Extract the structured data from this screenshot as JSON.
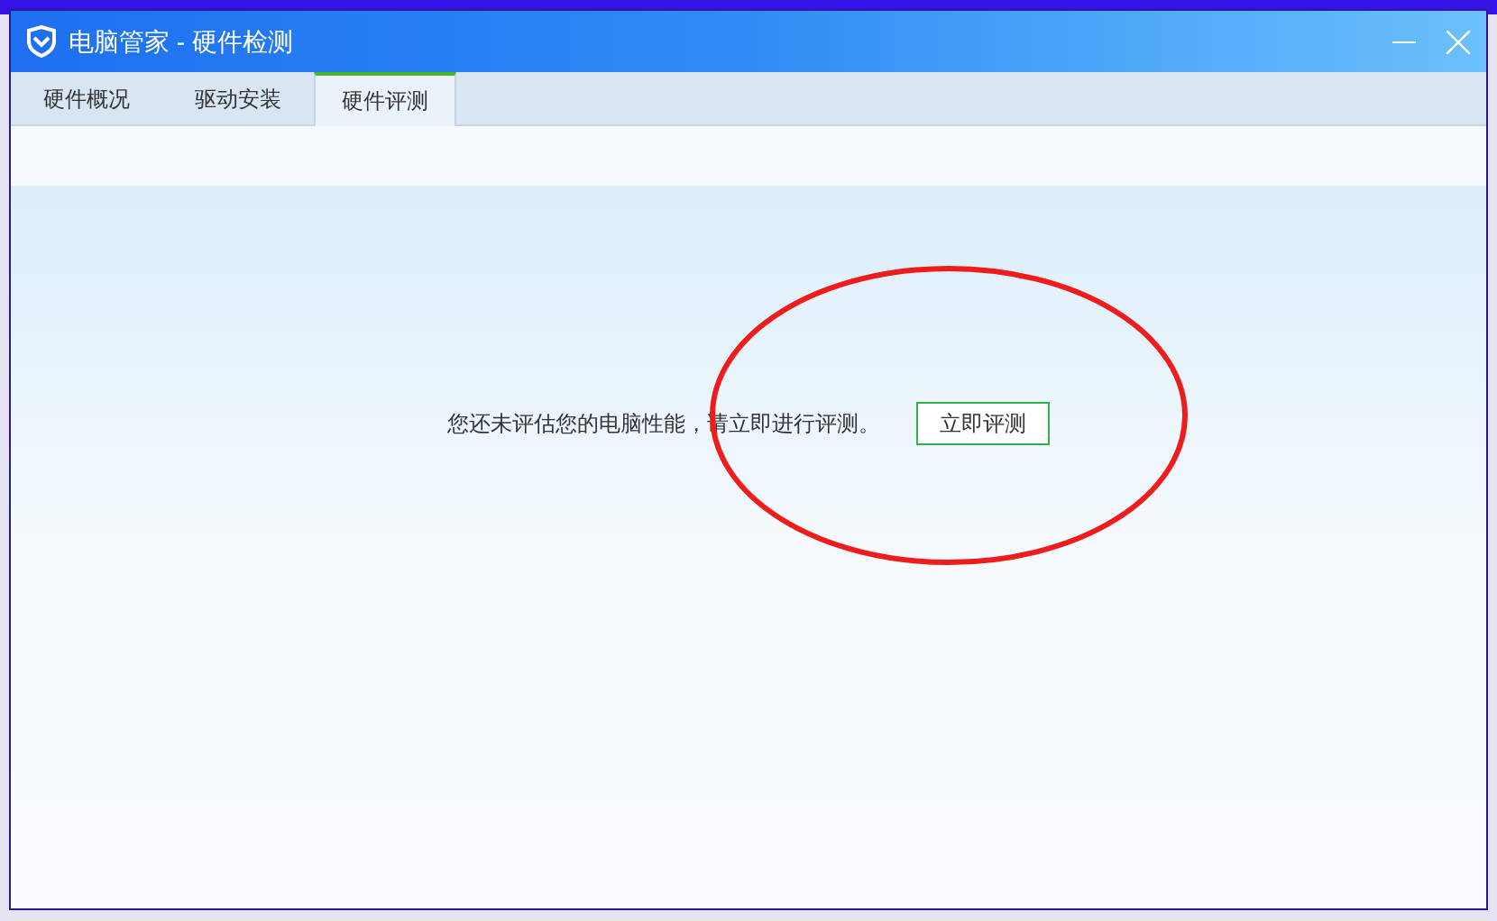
{
  "window": {
    "title": "电脑管家 - 硬件检测"
  },
  "tabs": [
    {
      "label": "硬件概况",
      "selected": false
    },
    {
      "label": "驱动安装",
      "selected": false
    },
    {
      "label": "硬件评测",
      "selected": true
    }
  ],
  "content": {
    "message": "您还未评估您的电脑性能，请立即进行评测。",
    "button": "立即评测"
  }
}
